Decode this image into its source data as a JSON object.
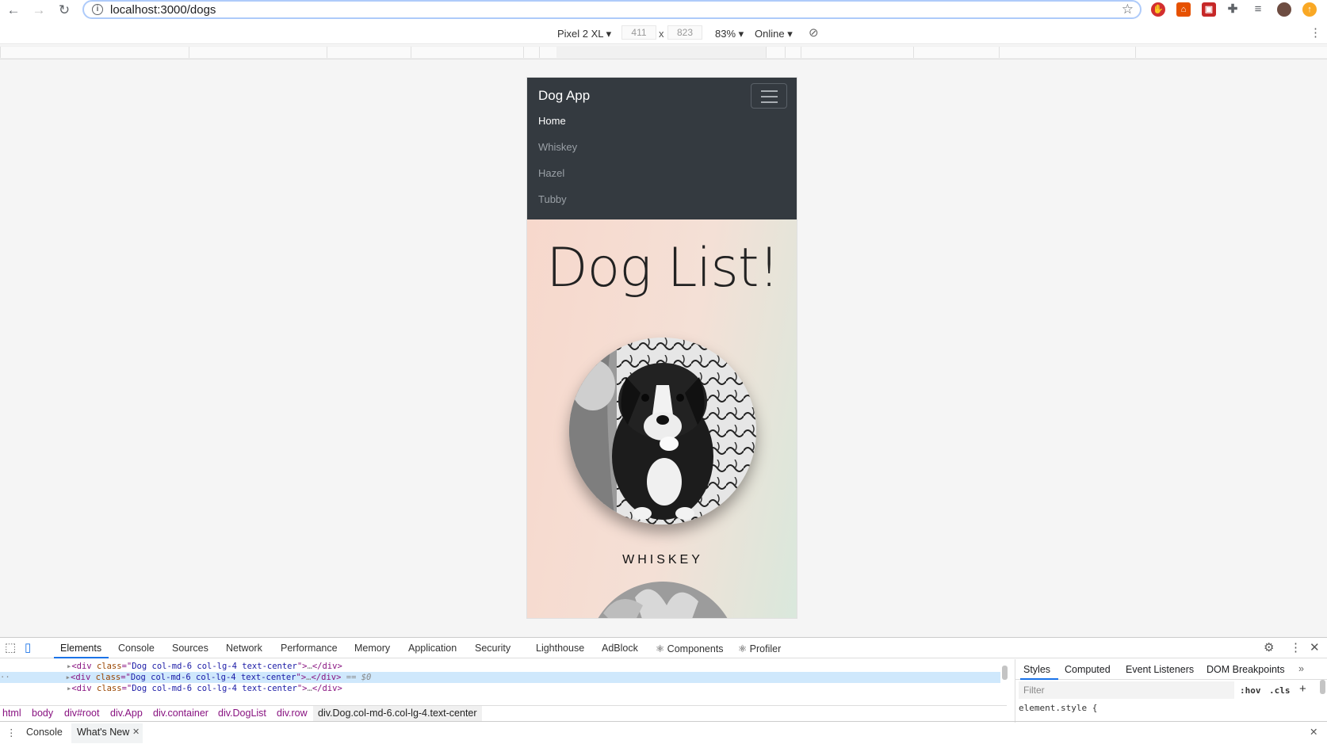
{
  "browser": {
    "url": "localhost:3000/dogs"
  },
  "device_toolbar": {
    "device": "Pixel 2 XL ▾",
    "width": "411",
    "times": "x",
    "height": "823",
    "zoom": "83% ▾",
    "network": "Online ▾"
  },
  "app": {
    "brand": "Dog App",
    "nav_links": [
      "Home",
      "Whiskey",
      "Hazel",
      "Tubby"
    ],
    "active_link": "Home",
    "title": "Dog List!",
    "dogs": [
      {
        "name": "WHISKEY"
      }
    ]
  },
  "devtools": {
    "tabs": [
      "Elements",
      "Console",
      "Sources",
      "Network",
      "Performance",
      "Memory",
      "Application",
      "Security",
      "Lighthouse",
      "AdBlock",
      "⚛ Components",
      "⚛ Profiler"
    ],
    "active_tab": "Elements",
    "dom_rows": [
      {
        "tag": "div",
        "attr": "class",
        "value": "Dog col-md-6 col-lg-4 text-center",
        "suffix": ""
      },
      {
        "tag": "div",
        "attr": "class",
        "value": "Dog col-md-6 col-lg-4 text-center",
        "suffix": " == $0"
      },
      {
        "tag": "div",
        "attr": "class",
        "value": "Dog col-md-6 col-lg-4 text-center",
        "suffix": ""
      }
    ],
    "breadcrumbs": [
      "html",
      "body",
      "div#root",
      "div.App",
      "div.container",
      "div.DogList",
      "div.row",
      "div.Dog.col-md-6.col-lg-4.text-center"
    ],
    "styles_tabs": [
      "Styles",
      "Computed",
      "Event Listeners",
      "DOM Breakpoints",
      "»"
    ],
    "filter_placeholder": "Filter",
    "hov": ":hov",
    "cls": ".cls",
    "element_style": "element.style {",
    "drawer_tabs": [
      "Console",
      "What's New"
    ]
  },
  "colors": {
    "navbar": "#343a40",
    "accent": "#1a73e8",
    "hero_start": "#f7d8cc",
    "hero_end": "#d9e8dc"
  }
}
